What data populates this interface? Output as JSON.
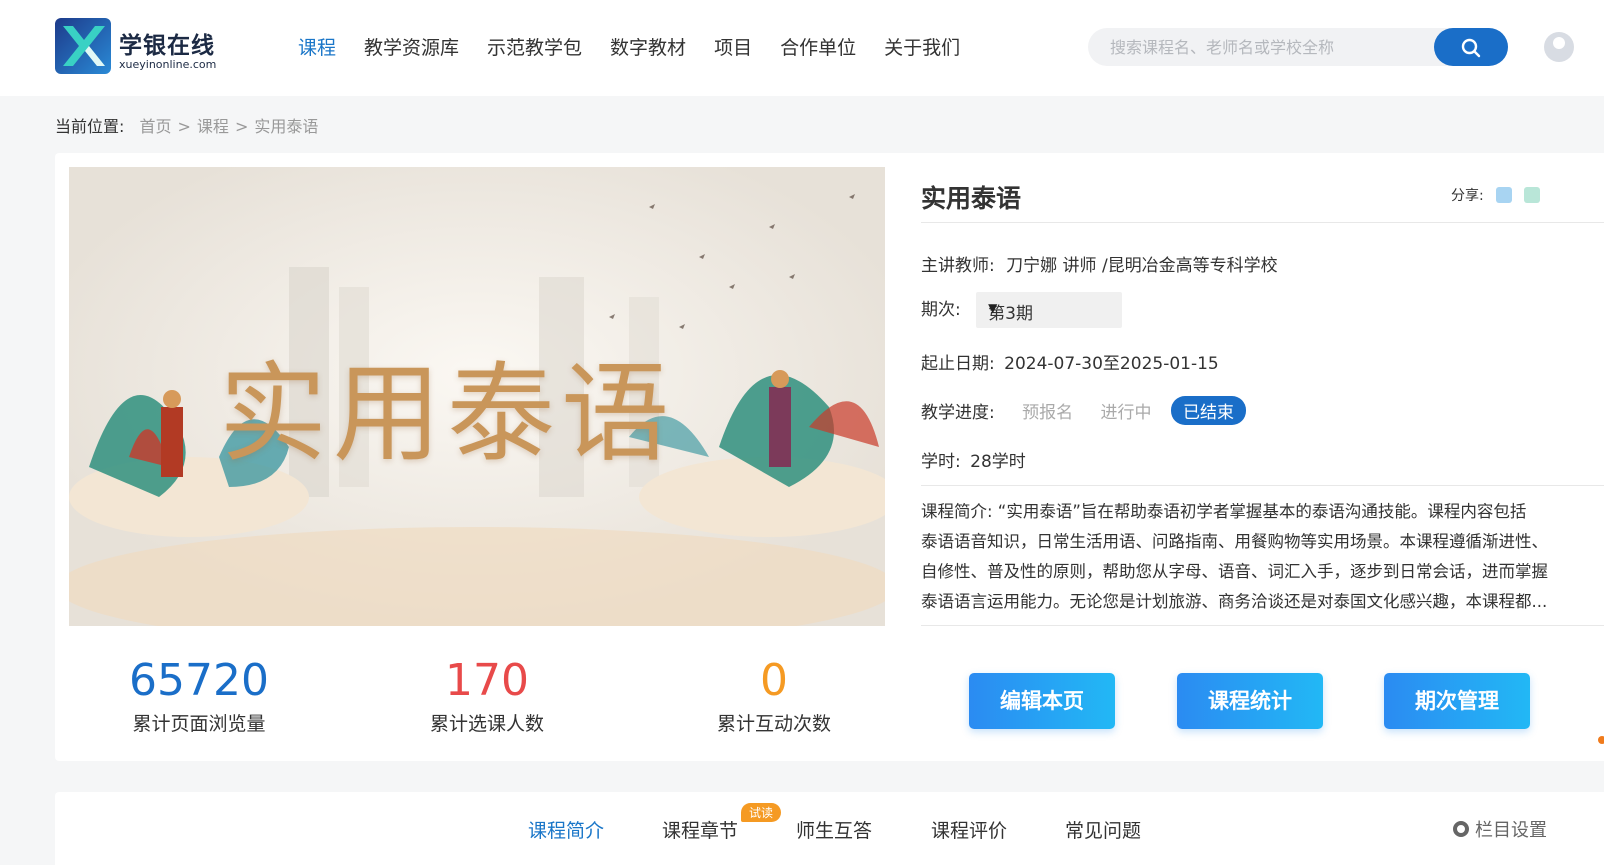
{
  "brand": {
    "name": "学银在线",
    "url_text": "xueyinonline.com"
  },
  "nav": {
    "items": [
      {
        "label": "课程",
        "active": true
      },
      {
        "label": "教学资源库",
        "active": false
      },
      {
        "label": "示范教学包",
        "active": false
      },
      {
        "label": "数字教材",
        "active": false
      },
      {
        "label": "项目",
        "active": false
      },
      {
        "label": "合作单位",
        "active": false
      },
      {
        "label": "关于我们",
        "active": false
      }
    ]
  },
  "search": {
    "placeholder": "搜索课程名、老师名或学校全称",
    "value": ""
  },
  "breadcrumb": {
    "prefix": "当前位置:",
    "items": [
      "首页",
      "课程",
      "实用泰语"
    ],
    "separator": ">"
  },
  "cover": {
    "title_text": "实用泰语"
  },
  "stats": [
    {
      "value": "65720",
      "label": "累计页面浏览量",
      "color": "#1a6ec8"
    },
    {
      "value": "170",
      "label": "累计选课人数",
      "color": "#e84a4a"
    },
    {
      "value": "0",
      "label": "累计互动次数",
      "color": "#f59a23"
    }
  ],
  "course": {
    "title": "实用泰语",
    "share_label": "分享:",
    "teacher_label": "主讲教师:",
    "teacher_value": "刀宁娜 讲师 /昆明冶金高等专科学校",
    "period_label": "期次:",
    "period_value": "第3期",
    "date_label": "起止日期:",
    "date_value": "2024-07-30至2025-01-15",
    "progress_label": "教学进度:",
    "progress_stages": [
      "预报名",
      "进行中",
      "已结束"
    ],
    "progress_current": "已结束",
    "hours_label": "学时:",
    "hours_value": "28学时",
    "intro_lines": [
      "课程简介:  “实用泰语”旨在帮助泰语初学者掌握基本的泰语沟通技能。课程内容包括",
      "泰语语音知识，日常生活用语、问路指南、用餐购物等实用场景。本课程遵循渐进性、",
      "自修性、普及性的原则，帮助您从字母、语音、词汇入手，逐步到日常会话，进而掌握",
      "泰语语言运用能力。无论您是计划旅游、商务洽谈还是对泰国文化感兴趣，本课程都..."
    ]
  },
  "actions": {
    "edit": "编辑本页",
    "stats": "课程统计",
    "periods": "期次管理"
  },
  "tabs": {
    "items": [
      "课程简介",
      "课程章节",
      "师生互答",
      "课程评价",
      "常见问题"
    ],
    "active": "课程简介",
    "trial_badge": "试读",
    "column_setting": "栏目设置"
  },
  "colors": {
    "accent": "#1a6ec8",
    "badge": "#f59a23"
  }
}
